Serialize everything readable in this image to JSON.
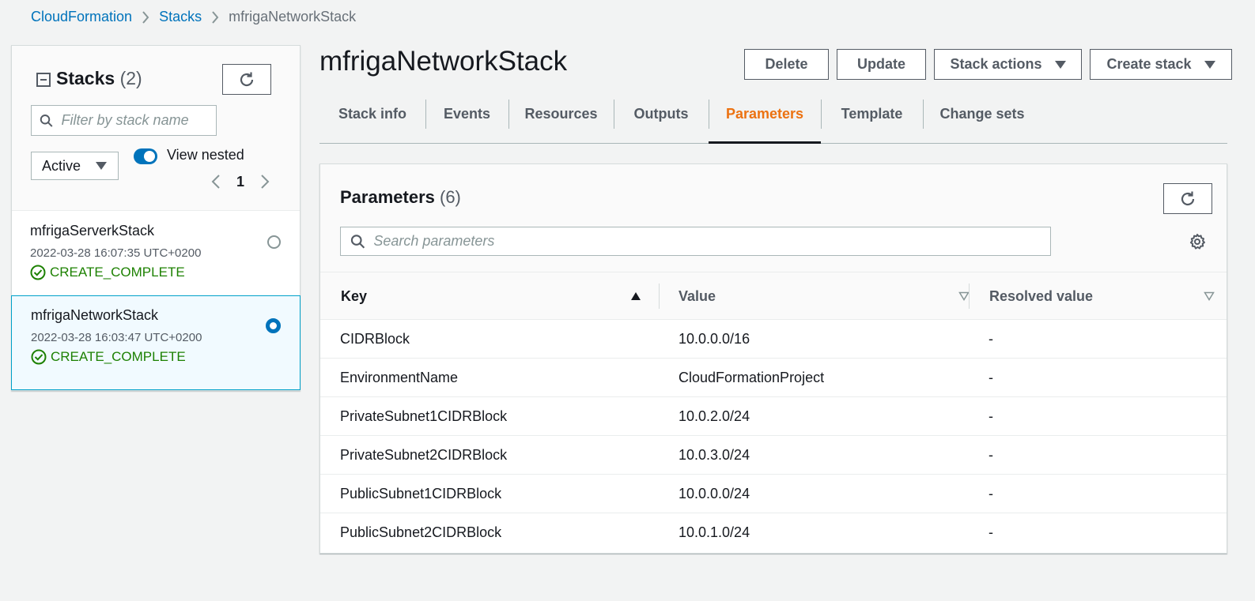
{
  "breadcrumb": {
    "items": [
      "CloudFormation",
      "Stacks"
    ],
    "current": "mfrigaNetworkStack"
  },
  "stacks_panel": {
    "title": "Stacks",
    "count": "(2)",
    "filter_placeholder": "Filter by stack name",
    "status_filter": "Active",
    "view_nested_label": "View nested",
    "view_nested_on": true,
    "page": "1",
    "items": [
      {
        "name": "mfrigaServerkStack",
        "date": "2022-03-28 16:07:35 UTC+0200",
        "status": "CREATE_COMPLETE",
        "selected": false
      },
      {
        "name": "mfrigaNetworkStack",
        "date": "2022-03-28 16:03:47 UTC+0200",
        "status": "CREATE_COMPLETE",
        "selected": true
      }
    ]
  },
  "page_title": "mfrigaNetworkStack",
  "actions": {
    "delete": "Delete",
    "update": "Update",
    "stack_actions": "Stack actions",
    "create_stack": "Create stack"
  },
  "tabs": [
    {
      "label": "Stack info"
    },
    {
      "label": "Events"
    },
    {
      "label": "Resources"
    },
    {
      "label": "Outputs"
    },
    {
      "label": "Parameters",
      "active": true
    },
    {
      "label": "Template"
    },
    {
      "label": "Change sets"
    }
  ],
  "parameters": {
    "title": "Parameters",
    "count": "(6)",
    "search_placeholder": "Search parameters",
    "columns": {
      "key": "Key",
      "value": "Value",
      "resolved": "Resolved value"
    },
    "rows": [
      {
        "key": "CIDRBlock",
        "value": "10.0.0.0/16",
        "resolved": "-"
      },
      {
        "key": "EnvironmentName",
        "value": "CloudFormationProject",
        "resolved": "-"
      },
      {
        "key": "PrivateSubnet1CIDRBlock",
        "value": "10.0.2.0/24",
        "resolved": "-"
      },
      {
        "key": "PrivateSubnet2CIDRBlock",
        "value": "10.0.3.0/24",
        "resolved": "-"
      },
      {
        "key": "PublicSubnet1CIDRBlock",
        "value": "10.0.0.0/24",
        "resolved": "-"
      },
      {
        "key": "PublicSubnet2CIDRBlock",
        "value": "10.0.1.0/24",
        "resolved": "-"
      }
    ]
  },
  "colors": {
    "link": "#0073bb",
    "active_tab": "#ec7211",
    "success": "#1d8102",
    "selected_bg": "#f1faff"
  }
}
